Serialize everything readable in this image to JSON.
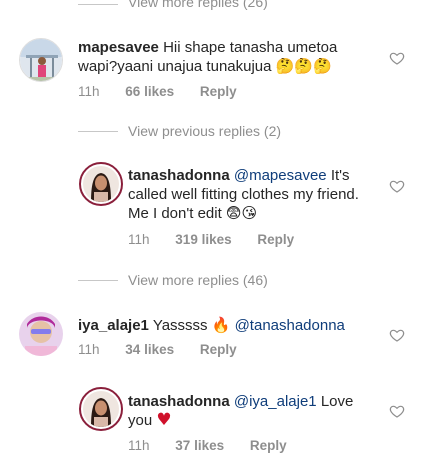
{
  "top_view_more": "View more replies (26)",
  "comment1": {
    "username": "mapesavee",
    "text": "Hii shape tanasha umetoa wapi?yaani unajua tunakujua",
    "emojis": "🤔🤔🤔",
    "time": "11h",
    "likes": "66 likes",
    "reply": "Reply"
  },
  "previous_replies": "View previous replies (2)",
  "reply1": {
    "username": "tanashadonna",
    "mention": "@mapesavee",
    "text": "It's called well fitting clothes my friend. Me I don't edit",
    "emojis": "😨😘",
    "time": "11h",
    "likes": "319 likes",
    "reply": "Reply"
  },
  "mid_view_more": "View more replies (46)",
  "comment2": {
    "username": "iya_alaje1",
    "text": "Yasssss",
    "emojis": "🔥",
    "mention": "@tanashadonna",
    "time": "11h",
    "likes": "34 likes",
    "reply": "Reply"
  },
  "reply2": {
    "username": "tanashadonna",
    "mention": "@iya_alaje1",
    "text": "Love you",
    "emojis": "♥",
    "time": "11h",
    "likes": "37 likes",
    "reply": "Reply"
  },
  "colors": {
    "text": "#262626",
    "muted": "#8e8e8e",
    "mention": "#0f3d7a",
    "heart_emoji": "#d0112b"
  },
  "icons": {
    "like": "heart-outline-icon"
  }
}
